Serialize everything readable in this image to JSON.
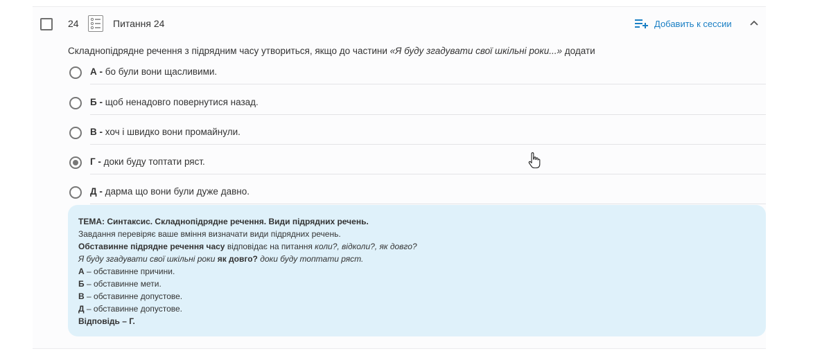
{
  "question": {
    "number": "24",
    "title": "Питання 24",
    "text_plain": "Складнопідрядне речення з підрядним часу утвориться, якщо до частини ",
    "text_quote": "«Я буду згадувати свої шкільні роки...»",
    "text_end": " додати"
  },
  "toolbar": {
    "add_to_session": "Добавить к сессии",
    "add_icon": "playlist-add-icon",
    "collapse_icon": "chevron-up-icon",
    "list_icon": "list-icon"
  },
  "options": [
    {
      "letter": "А -",
      "text": "бо були вони щасливими.",
      "selected": false
    },
    {
      "letter": "Б -",
      "text": "щоб ненадовго повернутися назад.",
      "selected": false
    },
    {
      "letter": "В -",
      "text": "хоч і швидко вони промайнули.",
      "selected": false
    },
    {
      "letter": "Г -",
      "text": "доки буду топтати ряст.",
      "selected": true
    },
    {
      "letter": "Д -",
      "text": "дарма що вони були дуже давно.",
      "selected": false
    }
  ],
  "explanation": {
    "topic": "ТЕМА: Синтаксис. Складнопідрядне речення. Види підрядних речень.",
    "line1": "Завдання перевіряє ваше вміння визначати види підрядних речень.",
    "line2_bold": "Обставинне підрядне речення часу",
    "line2_rest": " відповідає на питання ",
    "line2_italic": "коли?, відколи?, як довго?",
    "line3_italic_a": "Я буду згадувати свої шкільні роки ",
    "line3_bold": "як довго?",
    "line3_italic_b": " доки буду топтати ряст.",
    "items": [
      {
        "letter": "А",
        "text": " – обставинне причини."
      },
      {
        "letter": "Б",
        "text": " – обставинне мети."
      },
      {
        "letter": "В",
        "text": " – обставинне допустове."
      },
      {
        "letter": "Д",
        "text": " – обставинне допустове."
      }
    ],
    "answer": "Відповідь – Г."
  },
  "colors": {
    "accent": "#1a7fc4",
    "explanation_bg": "#dff1fa"
  }
}
